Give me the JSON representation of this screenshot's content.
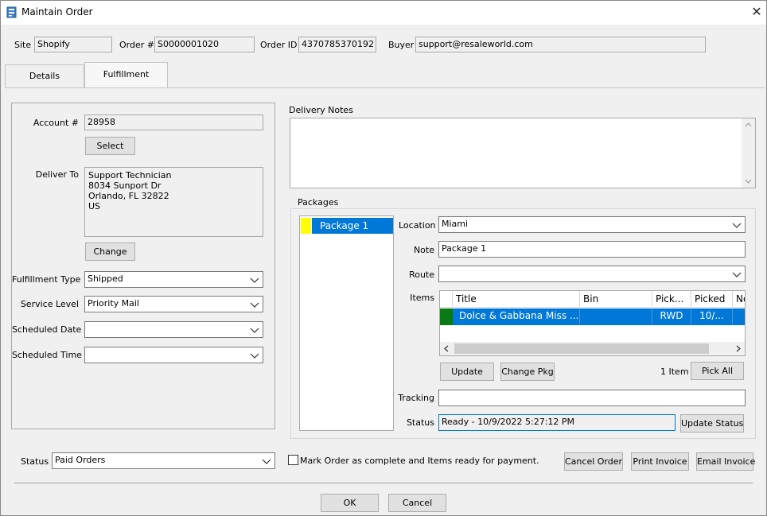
{
  "window": {
    "title": "Maintain Order",
    "close_glyph": "✕"
  },
  "header": {
    "site_label": "Site",
    "site_value": "Shopify",
    "order_no_label": "Order #",
    "order_no_value": "S0000001020",
    "order_id_label": "Order ID",
    "order_id_value": "4370785370192",
    "buyer_label": "Buyer",
    "buyer_value": "support@resaleworld.com"
  },
  "tabs": [
    {
      "label": "Details",
      "active": false
    },
    {
      "label": "Fulfillment",
      "active": true
    }
  ],
  "left": {
    "account_label": "Account #",
    "account_value": "28958",
    "select_button": "Select",
    "deliver_to_label": "Deliver To",
    "deliver_to_lines": [
      "Support Technician",
      "8034 Sunport Dr",
      "Orlando, FL  32822",
      "US"
    ],
    "change_button": "Change",
    "fulfillment_type_label": "Fulfillment Type",
    "fulfillment_type_value": "Shipped",
    "service_level_label": "Service Level",
    "service_level_value": "Priority Mail",
    "scheduled_date_label": "Scheduled Date",
    "scheduled_date_value": "",
    "scheduled_time_label": "Scheduled Time",
    "scheduled_time_value": ""
  },
  "delivery_notes": {
    "label": "Delivery Notes",
    "value": ""
  },
  "packages": {
    "label": "Packages",
    "list": [
      {
        "name": "Package 1",
        "color": "#ffff00",
        "selected": true
      }
    ],
    "location_label": "Location",
    "location_value": "Miami",
    "note_label": "Note",
    "note_value": "Package 1",
    "route_label": "Route",
    "route_value": "",
    "items_label": "Items",
    "items_columns": [
      "Title",
      "Bin",
      "Pick...",
      "Picked",
      "No"
    ],
    "items_rows": [
      {
        "color": "#0a7a14",
        "title": "Dolce & Gabbana Miss ...",
        "bin": "",
        "pick": "RWD",
        "picked": "10/...",
        "no": ""
      }
    ],
    "update_button": "Update",
    "change_pkg_button": "Change Pkg",
    "item_count": "1 Item",
    "pick_all_button": "Pick All",
    "tracking_label": "Tracking",
    "tracking_value": "",
    "status_label": "Status",
    "status_value": "Ready - 10/9/2022 5:27:12 PM",
    "update_status_button": "Update Status"
  },
  "footer": {
    "status_label": "Status",
    "status_value": "Paid Orders",
    "mark_complete_label": "Mark Order as complete and Items ready for payment.",
    "mark_complete_checked": false,
    "cancel_order_button": "Cancel Order",
    "print_invoice_button": "Print Invoice",
    "email_invoice_button": "Email Invoice",
    "ok_button": "OK",
    "cancel_button": "Cancel"
  },
  "colors": {
    "selection": "#0078d7",
    "package_marker": "#ffff00",
    "item_marker": "#0a7a14"
  }
}
